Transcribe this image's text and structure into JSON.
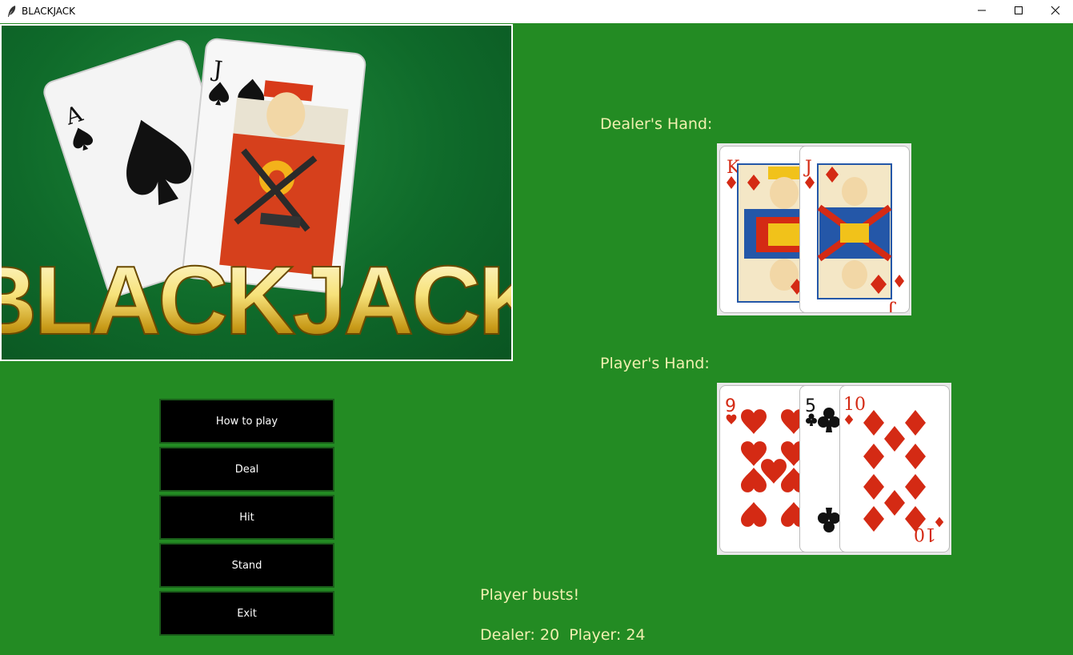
{
  "window": {
    "title": "BLACKJACK",
    "icon": "feather-icon",
    "controls": [
      "minimize-icon",
      "maximize-icon",
      "close-icon"
    ]
  },
  "banner": {
    "logo_text": "BLACKJACK",
    "cards": [
      {
        "rank": "A",
        "suit": "spades"
      },
      {
        "rank": "J",
        "suit": "spades"
      }
    ]
  },
  "buttons": {
    "how_to_play": "How to play",
    "deal": "Deal",
    "hit": "Hit",
    "stand": "Stand",
    "exit": "Exit"
  },
  "dealer": {
    "label": "Dealer's Hand:",
    "cards": [
      {
        "rank": "K",
        "suit": "diamonds"
      },
      {
        "rank": "J",
        "suit": "diamonds"
      }
    ]
  },
  "player": {
    "label": "Player's Hand:",
    "cards": [
      {
        "rank": "9",
        "suit": "hearts"
      },
      {
        "rank": "5",
        "suit": "clubs"
      },
      {
        "rank": "10",
        "suit": "diamonds"
      }
    ]
  },
  "status": {
    "message": "Player busts!",
    "score_line": "Dealer: 20  Player: 24"
  },
  "colors": {
    "table_green": "#238b23",
    "label_text": "#f0f0b0",
    "button_bg": "#000000",
    "red_suit": "#d42a14"
  }
}
